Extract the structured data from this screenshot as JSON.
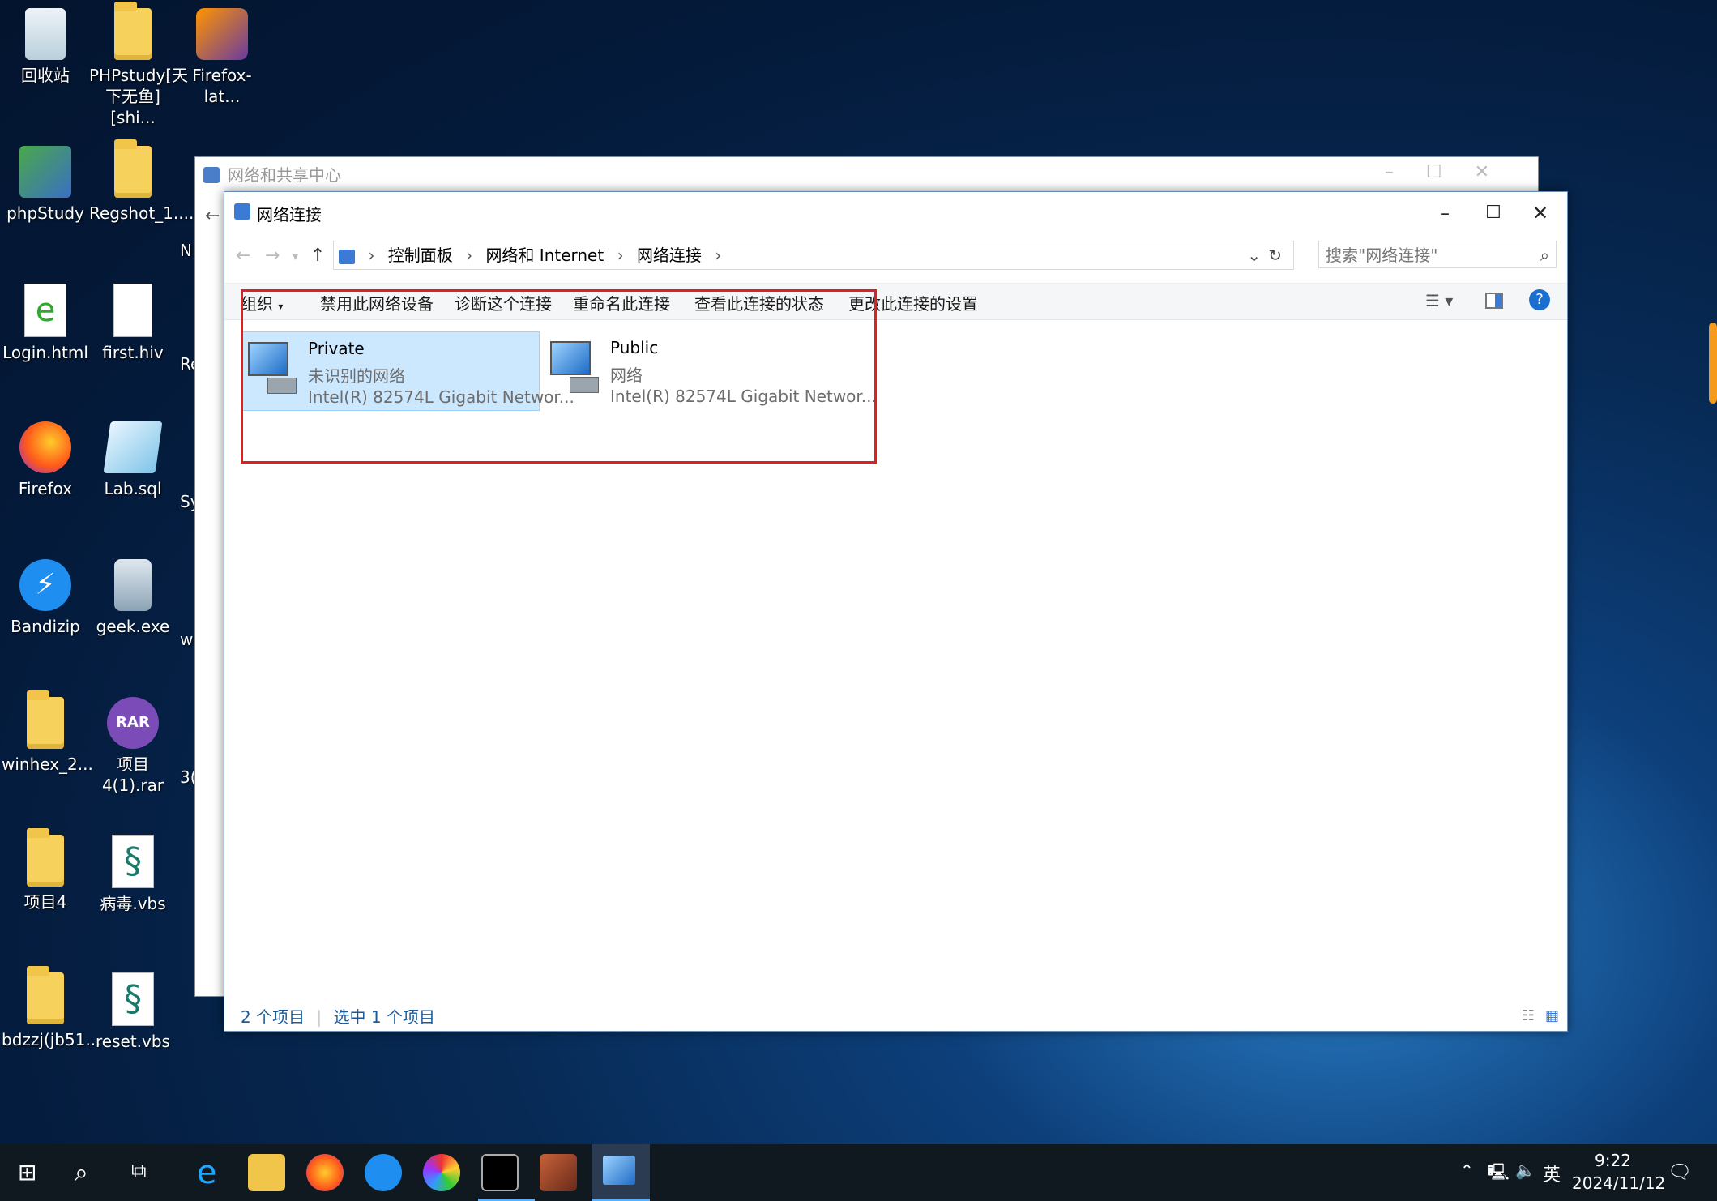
{
  "desktop": {
    "icons": [
      {
        "label": "回收站",
        "icon": "recycle-bin-icon"
      },
      {
        "label": "PHPstudy[天下无鱼][shi...",
        "icon": "folder-icon"
      },
      {
        "label": "Firefox-lat...",
        "icon": "installer-icon"
      },
      {
        "label": "phpStudy",
        "icon": "phpstudy-icon"
      },
      {
        "label": "Regshot_1....",
        "icon": "folder-icon"
      },
      {
        "label": "Login.html",
        "icon": "html-file-icon"
      },
      {
        "label": "first.hiv",
        "icon": "file-icon"
      },
      {
        "label": "Firefox",
        "icon": "firefox-icon"
      },
      {
        "label": "Lab.sql",
        "icon": "sql-file-icon"
      },
      {
        "label": "Bandizip",
        "icon": "bandizip-icon"
      },
      {
        "label": "geek.exe",
        "icon": "exe-icon"
      },
      {
        "label": "winhex_2...",
        "icon": "folder-icon"
      },
      {
        "label": "项目4(1).rar",
        "icon": "rar-icon"
      },
      {
        "label": "项目4",
        "icon": "folder-icon"
      },
      {
        "label": "病毒.vbs",
        "icon": "vbs-file-icon"
      },
      {
        "label": "bdzzj(jb51...",
        "icon": "folder-icon"
      },
      {
        "label": "reset.vbs",
        "icon": "vbs-file-icon"
      }
    ],
    "partial_labels": [
      "N",
      "Re",
      "Sy",
      "w",
      "3("
    ]
  },
  "back_window": {
    "title": "网络和共享中心"
  },
  "window": {
    "title": "网络连接",
    "address": {
      "crumbs": [
        "控制面板",
        "网络和 Internet",
        "网络连接"
      ],
      "search_placeholder": "搜索\"网络连接\""
    },
    "toolbar": {
      "organize": "组织",
      "disable": "禁用此网络设备",
      "diagnose": "诊断这个连接",
      "rename": "重命名此连接",
      "view_status": "查看此连接的状态",
      "change_settings": "更改此连接的设置"
    },
    "connections": [
      {
        "name": "Private",
        "status": "未识别的网络",
        "device": "Intel(R) 82574L Gigabit Networ...",
        "selected": true
      },
      {
        "name": "Public",
        "status": "网络",
        "device": "Intel(R) 82574L Gigabit Networ...",
        "selected": false
      }
    ],
    "statusbar": {
      "count": "2 个项目",
      "selected": "选中 1 个项目"
    }
  },
  "taskbar": {
    "time": "9:22",
    "date": "2024/11/12",
    "ime": "英"
  },
  "colors": {
    "highlight": "#e02020",
    "selection": "#cce8ff",
    "accent": "#0078d7"
  }
}
